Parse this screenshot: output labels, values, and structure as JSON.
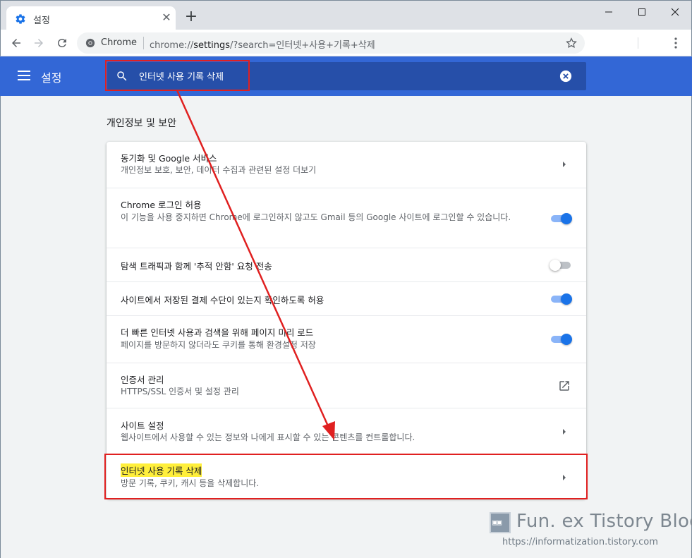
{
  "tab": {
    "title": "설정",
    "favicon": "gear-icon"
  },
  "window": {
    "minimize": "minimize-icon",
    "maximize": "maximize-icon",
    "close": "close-icon"
  },
  "toolbar": {
    "origin_label": "Chrome",
    "url_scheme": "chrome://",
    "url_host": "settings",
    "url_rest": "/?search=인터넷+사용+기록+삭제"
  },
  "header": {
    "title": "설정",
    "search_value": "인터넷 사용 기록 삭제"
  },
  "section": {
    "title": "개인정보 및 보안"
  },
  "rows": [
    {
      "title": "동기화 및 Google 서비스",
      "sub": "개인정보 보호, 보안, 데이터 수집과 관련된 설정 더보기",
      "control": "arrow"
    },
    {
      "title": "Chrome 로그인 허용",
      "sub": "이 기능을 사용 중지하면 Chrome에 로그인하지 않고도 Gmail 등의 Google 사이트에 로그인할 수 있습니다.",
      "control": "toggle",
      "state": true
    },
    {
      "title": "탐색 트래픽과 함께 '추적 안함' 요청 전송",
      "control": "toggle",
      "state": false
    },
    {
      "title": "사이트에서 저장된 결제 수단이 있는지 확인하도록 허용",
      "control": "toggle",
      "state": true
    },
    {
      "title": "더 빠른 인터넷 사용과 검색을 위해 페이지 미리 로드",
      "sub": "페이지를 방문하지 않더라도 쿠키를 통해 환경설정 저장",
      "control": "toggle",
      "state": true
    },
    {
      "title": "인증서 관리",
      "sub": "HTTPS/SSL 인증서 및 설정 관리",
      "control": "external"
    },
    {
      "title": "사이트 설정",
      "sub": "웹사이트에서 사용할 수 있는 정보와 나에게 표시할 수 있는 콘텐츠를 컨트롤합니다.",
      "control": "arrow"
    },
    {
      "title": "인터넷 사용 기록 삭제",
      "sub": "방문 기록, 쿠키, 캐시 등을 삭제합니다.",
      "control": "arrow",
      "highlight": true
    }
  ],
  "colors": {
    "accent": "#3367d6",
    "toggle_on": "#1a73e8",
    "annotation": "#e02020",
    "highlight": "#ffef3b"
  },
  "watermark": {
    "title": "Fun. ex Tistory Blog",
    "url": "https://informatization.tistory.com"
  }
}
